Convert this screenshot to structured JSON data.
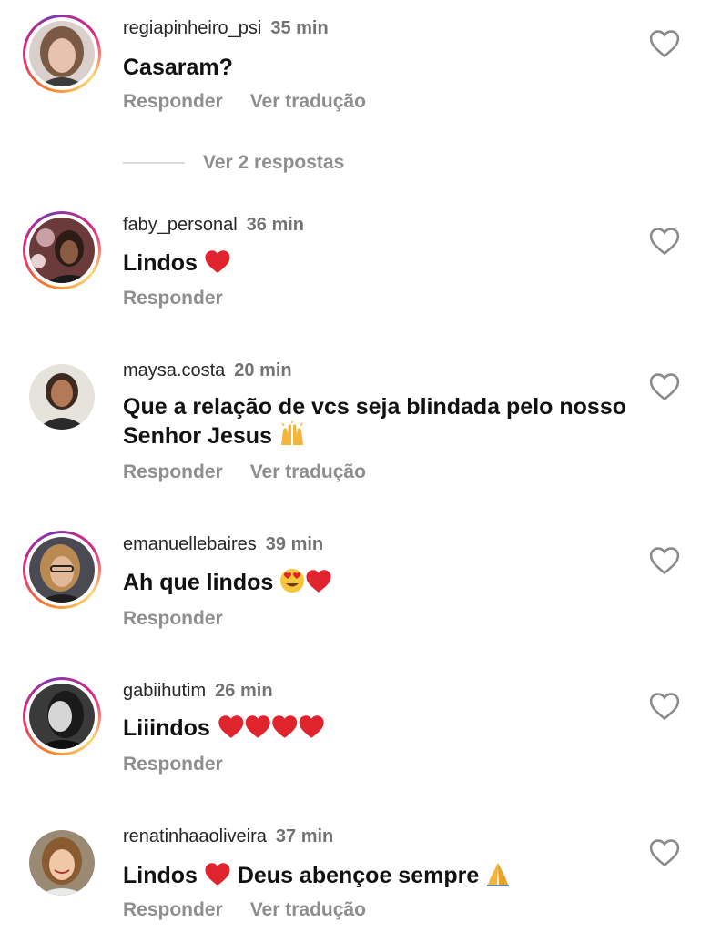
{
  "comments": [
    {
      "username": "regiapinheiro_psi",
      "time": "35 min",
      "text": "Casaram?",
      "reply": "Responder",
      "translate": "Ver tradução"
    },
    {
      "username": "faby_personal",
      "time": "36 min",
      "text": "Lindos",
      "reply": "Responder"
    },
    {
      "username": "maysa.costa",
      "time": "20 min",
      "text_line1": "Que a relação de vcs seja blindada pelo nosso",
      "text_line2": "Senhor Jesus",
      "reply": "Responder",
      "translate": "Ver tradução"
    },
    {
      "username": "emanuellebaires",
      "time": "39 min",
      "text": "Ah que lindos",
      "reply": "Responder"
    },
    {
      "username": "gabiihutim",
      "time": "26 min",
      "text": "Liiindos",
      "reply": "Responder"
    },
    {
      "username": "renatinhaaoliveira",
      "time": "37 min",
      "text_a": "Lindos",
      "text_b": "Deus abençoe sempre",
      "reply": "Responder",
      "translate": "Ver tradução"
    }
  ],
  "view_replies": "Ver 2 respostas",
  "icons": {
    "like": "heart-outline-icon",
    "emoji_heart": "red-heart-emoji",
    "emoji_praise": "raising-hands-emoji",
    "emoji_love_eyes": "heart-eyes-emoji",
    "emoji_pray": "folded-hands-emoji"
  },
  "colors": {
    "ring_start": "#f58529",
    "ring_mid": "#dd2a7b",
    "ring_end": "#8134af",
    "heart_emoji": "#e0242e",
    "secondary_text": "#8e8e8e"
  }
}
